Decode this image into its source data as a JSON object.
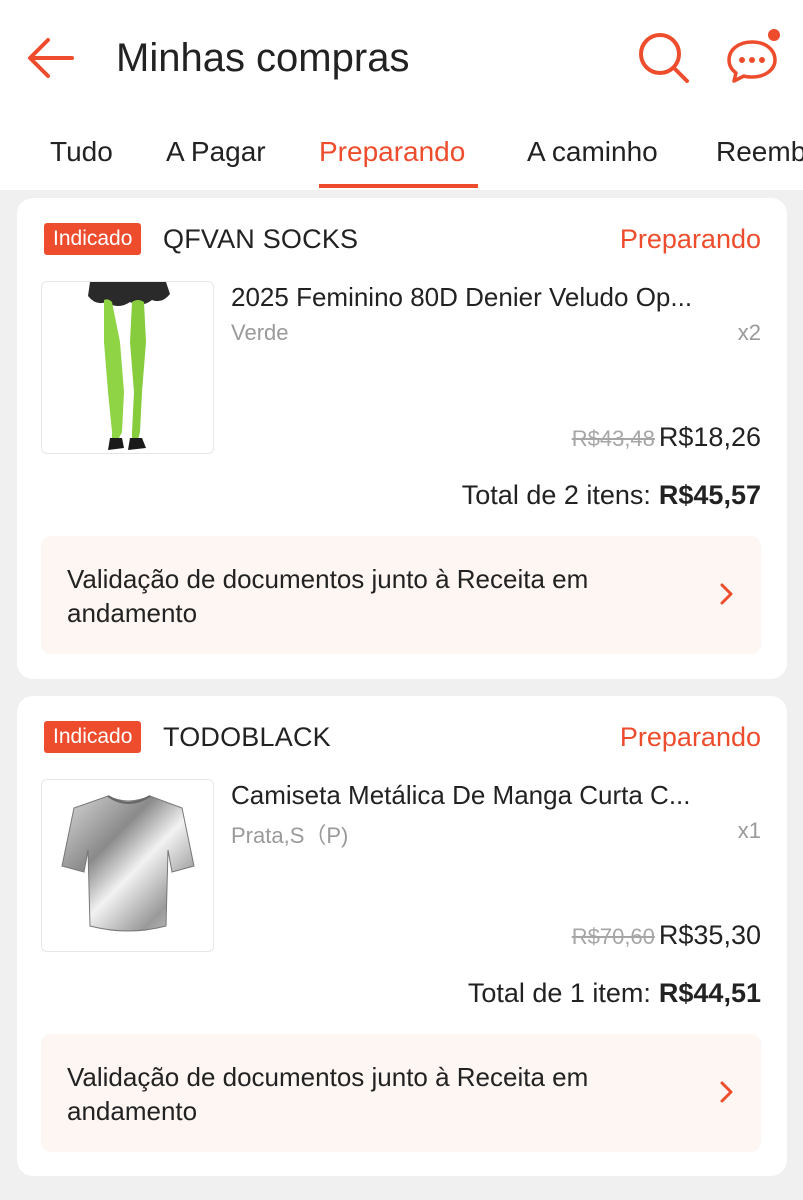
{
  "header": {
    "title": "Minhas compras",
    "back_icon": "arrow-left-icon",
    "search_icon": "search-icon",
    "chat_icon": "chat-bubble-icon",
    "accent": "#ee4d2d"
  },
  "tabs": [
    {
      "label": "Tudo",
      "active": false
    },
    {
      "label": "A Pagar",
      "active": false
    },
    {
      "label": "Preparando",
      "active": true
    },
    {
      "label": "A caminho",
      "active": false
    },
    {
      "label": "Reemb",
      "active": false
    }
  ],
  "orders": [
    {
      "badge": "Indicado",
      "shop": "QFVAN SOCKS",
      "status": "Preparando",
      "product": {
        "name": "2025 Feminino 80D Denier Veludo Op...",
        "variant": "Verde",
        "qty": "x2",
        "old_price": "R$43,48",
        "price": "R$18,26"
      },
      "total_label": "Total de 2 itens:",
      "total_amount": "R$45,57",
      "notice": "Validação de documentos junto à Receita em andamento"
    },
    {
      "badge": "Indicado",
      "shop": "TODOBLACK",
      "status": "Preparando",
      "product": {
        "name": "Camiseta Metálica De Manga Curta C...",
        "variant": "Prata,S（P)",
        "qty": "x1",
        "old_price": "R$70,60",
        "price": "R$35,30"
      },
      "total_label": "Total de 1 item:",
      "total_amount": "R$44,51",
      "notice": "Validação de documentos junto à Receita em andamento"
    }
  ]
}
